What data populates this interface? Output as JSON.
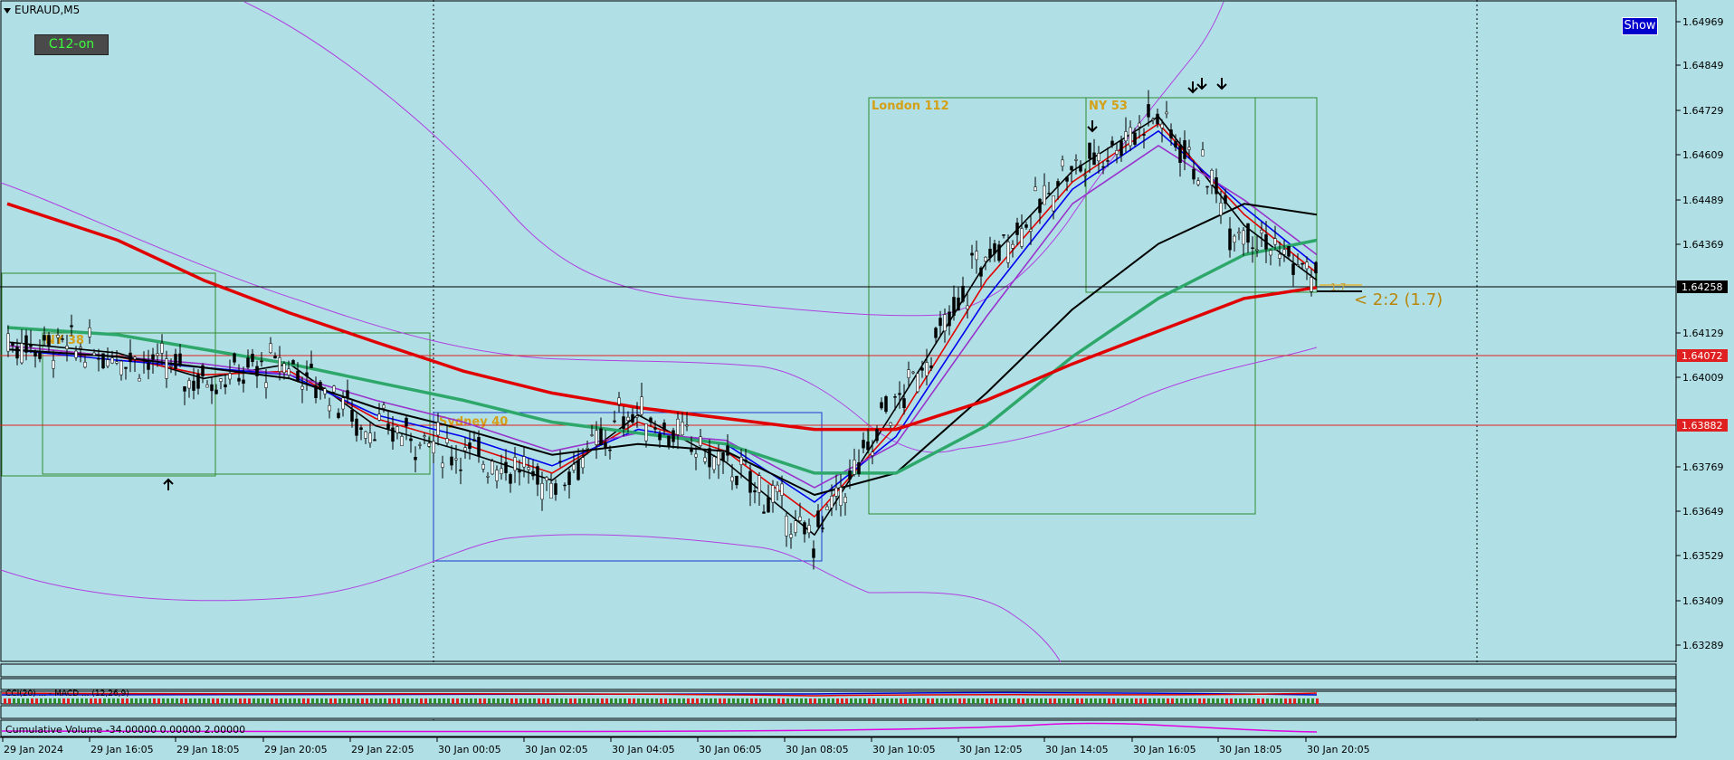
{
  "symbol": "EURAUD,M5",
  "c12_button": "C12-on",
  "show_button": "Show",
  "price_axis": {
    "ticks": [
      "1.64969",
      "1.64849",
      "1.64729",
      "1.64609",
      "1.64489",
      "1.64369",
      "1.64129",
      "1.64009",
      "1.63769",
      "1.63649",
      "1.63529",
      "1.63409",
      "1.63289"
    ],
    "current_price": "1.64258",
    "levels": [
      {
        "price": "1.64072",
        "color": "#e02020"
      },
      {
        "price": "1.63882",
        "color": "#e02020"
      }
    ]
  },
  "time_axis": [
    "29 Jan 2024",
    "29 Jan 16:05",
    "29 Jan 18:05",
    "29 Jan 20:05",
    "29 Jan 22:05",
    "30 Jan 00:05",
    "30 Jan 02:05",
    "30 Jan 04:05",
    "30 Jan 06:05",
    "30 Jan 08:05",
    "30 Jan 10:05",
    "30 Jan 12:05",
    "30 Jan 14:05",
    "30 Jan 16:05",
    "30 Jan 18:05",
    "30 Jan 20:05"
  ],
  "session_boxes": [
    {
      "label": "NY 38",
      "color": "#2e8b2e"
    },
    {
      "label": "Sydney 40",
      "color": "#1a3acc"
    },
    {
      "label": "London 112",
      "color": "#2e8b2e"
    },
    {
      "label": "NY 53",
      "color": "#2e8b2e"
    }
  ],
  "annotations": {
    "rr_text": "< 2:2 (1.7)",
    "small_label": "1.7"
  },
  "subpanels": {
    "indicator_text": "CCI(20) ...  -  MACD  ... (12,26,9)",
    "volume_text": "Cumulative Volume -34.00000 0.00000 2.00000"
  },
  "chart_data": {
    "type": "line",
    "title": "EURAUD,M5",
    "xlabel": "",
    "ylabel": "",
    "ylim": [
      1.632,
      1.6502
    ],
    "x": [
      "29 Jan 2024",
      "29 Jan 16:05",
      "29 Jan 18:05",
      "29 Jan 20:05",
      "29 Jan 22:05",
      "30 Jan 00:05",
      "30 Jan 02:05",
      "30 Jan 04:05",
      "30 Jan 06:05",
      "30 Jan 08:05",
      "30 Jan 10:05",
      "30 Jan 12:05",
      "30 Jan 14:05",
      "30 Jan 16:05",
      "30 Jan 18:05",
      "30 Jan 20:05"
    ],
    "series": [
      {
        "values": [
          1.6408,
          1.6405,
          1.6398,
          1.6402,
          1.6385,
          1.6378,
          1.637,
          1.6388,
          1.6375,
          1.6355,
          1.639,
          1.643,
          1.6455,
          1.647,
          1.644,
          1.6425
        ],
        "color": "#000000"
      },
      {
        "values": [
          1.6407,
          1.6404,
          1.6399,
          1.64,
          1.6387,
          1.638,
          1.6372,
          1.6386,
          1.6378,
          1.636,
          1.6385,
          1.6425,
          1.6452,
          1.6468,
          1.6443,
          1.6427
        ],
        "color": "#e00000"
      },
      {
        "values": [
          1.6406,
          1.6403,
          1.6401,
          1.6399,
          1.6388,
          1.6382,
          1.6374,
          1.6384,
          1.638,
          1.6364,
          1.6382,
          1.642,
          1.645,
          1.6466,
          1.6445,
          1.6429
        ],
        "color": "#0000ee"
      },
      {
        "values": [
          1.6407,
          1.6404,
          1.6402,
          1.6399,
          1.6392,
          1.6386,
          1.6378,
          1.6383,
          1.6381,
          1.6368,
          1.638,
          1.6415,
          1.6446,
          1.6462,
          1.6447,
          1.6432
        ],
        "color": "#9933cc"
      },
      {
        "values": [
          1.6406,
          1.6404,
          1.6401,
          1.6398,
          1.639,
          1.6384,
          1.6377,
          1.638,
          1.6378,
          1.6366,
          1.6372,
          1.6394,
          1.6417,
          1.6435,
          1.6446,
          1.6443
        ],
        "color": "#000000"
      },
      {
        "values": [
          1.6412,
          1.641,
          1.6406,
          1.6402,
          1.6397,
          1.6392,
          1.6386,
          1.6383,
          1.638,
          1.6372,
          1.6372,
          1.6385,
          1.6404,
          1.642,
          1.6432,
          1.6436
        ],
        "color": "#2ea86a"
      },
      {
        "values": [
          1.6446,
          1.6436,
          1.6425,
          1.6416,
          1.6408,
          1.64,
          1.6394,
          1.639,
          1.6387,
          1.6384,
          1.6384,
          1.6392,
          1.6402,
          1.6411,
          1.642,
          1.6423
        ],
        "color": "#e00000"
      }
    ],
    "grid": false,
    "legend": "none"
  }
}
